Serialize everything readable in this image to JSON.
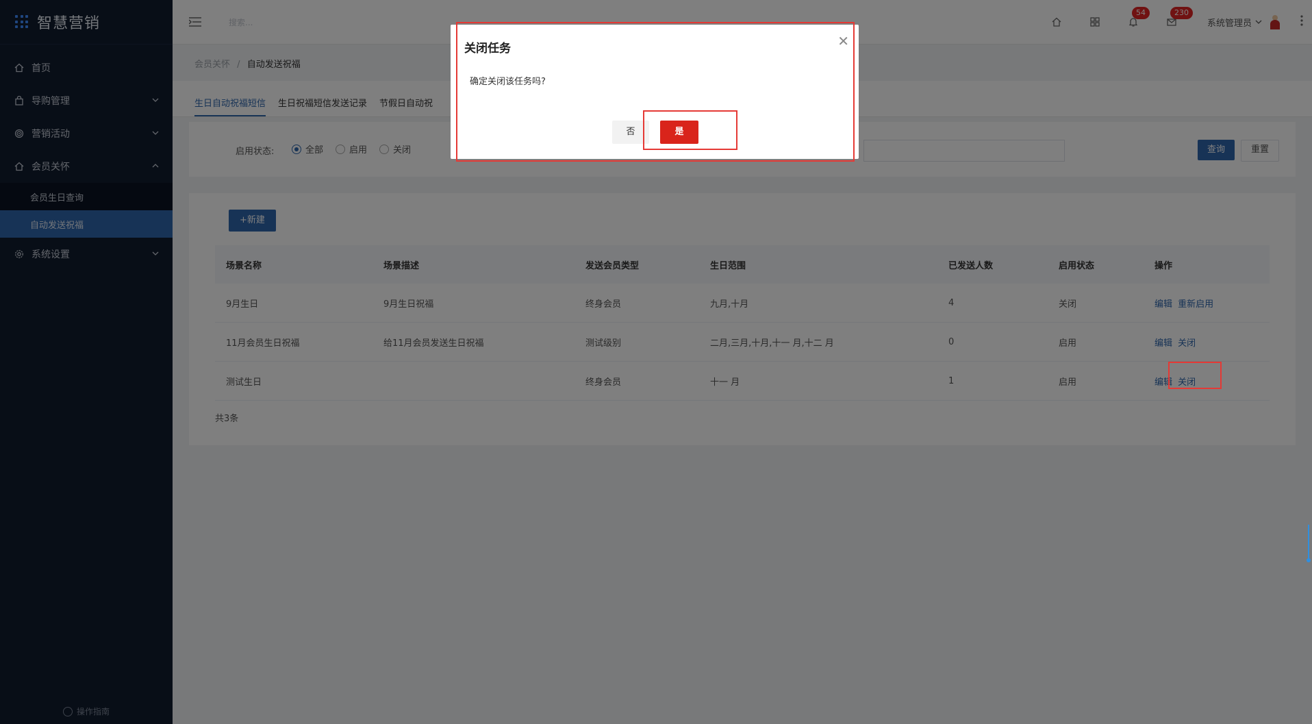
{
  "app": {
    "title": "智慧营销"
  },
  "sidebar": {
    "items": [
      {
        "label": "首页",
        "icon": "home-icon"
      },
      {
        "label": "导购管理",
        "icon": "bag-icon"
      },
      {
        "label": "营销活动",
        "icon": "target-icon"
      },
      {
        "label": "会员关怀",
        "icon": "home-icon"
      }
    ],
    "sub_items": [
      {
        "label": "会员生日查询"
      },
      {
        "label": "自动发送祝福"
      }
    ],
    "settings": {
      "label": "系统设置"
    },
    "footer": "操作指南"
  },
  "topbar": {
    "search_placeholder": "搜索...",
    "notifications_count": "54",
    "messages_count": "230",
    "user_name": "系统管理员"
  },
  "breadcrumb": {
    "parent": "会员关怀",
    "separator": "/",
    "current": "自动发送祝福"
  },
  "tabs": [
    {
      "label": "生日自动祝福短信"
    },
    {
      "label": "生日祝福短信发送记录"
    },
    {
      "label": "节假日自动祝"
    }
  ],
  "filter": {
    "status_label": "启用状态:",
    "options": [
      {
        "label": "全部"
      },
      {
        "label": "启用"
      },
      {
        "label": "关闭"
      }
    ],
    "selected": "全部",
    "query_button": "查询",
    "reset_button": "重置"
  },
  "list": {
    "new_button": "+新建",
    "columns": [
      "场景名称",
      "场景描述",
      "发送会员类型",
      "生日范围",
      "已发送人数",
      "启用状态",
      "操作"
    ],
    "rows": [
      {
        "name": "9月生日",
        "desc": "9月生日祝福",
        "type": "终身会员",
        "range": "九月,十月",
        "sent": "4",
        "status": "关闭",
        "actions": [
          "编辑",
          "重新启用"
        ]
      },
      {
        "name": "11月会员生日祝福",
        "desc": "给11月会员发送生日祝福",
        "type": "测试级别",
        "range": "二月,三月,十月,十一 月,十二 月",
        "sent": "0",
        "status": "启用",
        "actions": [
          "编辑",
          "关闭"
        ]
      },
      {
        "name": "测试生日",
        "desc": "",
        "type": "终身会员",
        "range": "十一 月",
        "sent": "1",
        "status": "启用",
        "actions": [
          "编辑",
          "关闭"
        ]
      }
    ],
    "total": "共3条"
  },
  "dialog": {
    "title": "关闭任务",
    "message": "确定关闭该任务吗?",
    "no_button": "否",
    "yes_button": "是"
  },
  "colors": {
    "sidebar_bg": "#111c2e",
    "accent": "#2f66ad",
    "danger": "#d9241b",
    "highlight": "#e53935"
  }
}
